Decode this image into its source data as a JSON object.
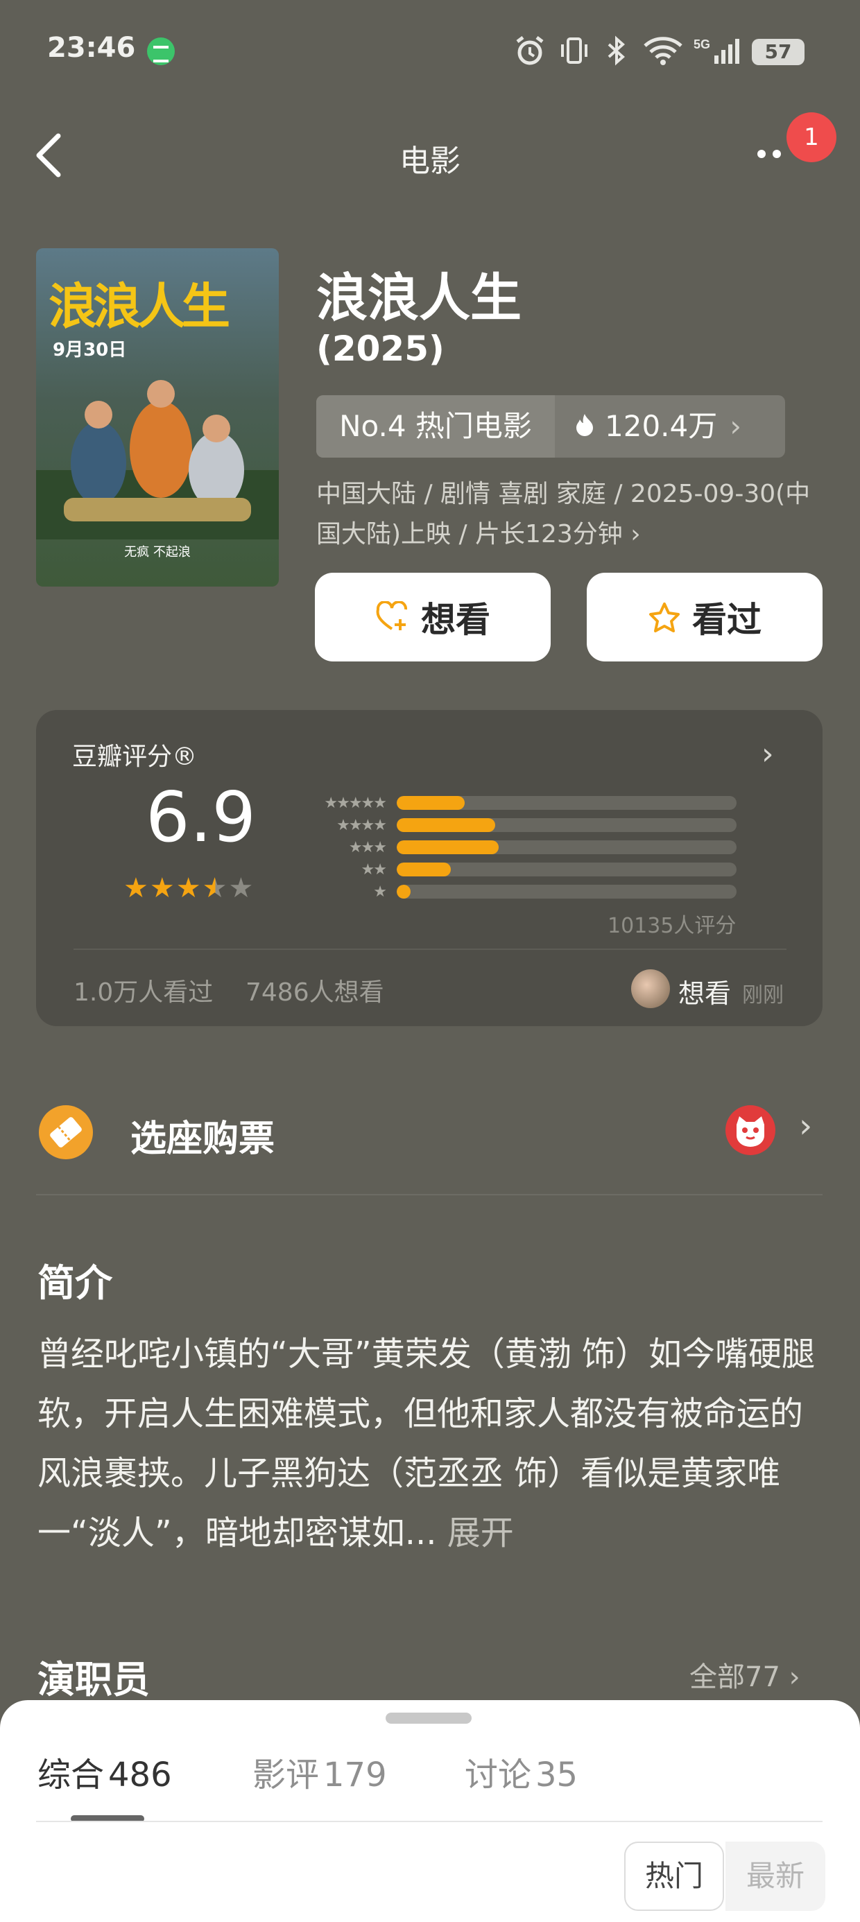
{
  "status_bar": {
    "time": "23:46",
    "battery": "57",
    "icons": [
      "message-app-icon",
      "alarm-icon",
      "vibrate-icon",
      "bluetooth-icon",
      "wifi-icon",
      "signal-5g-icon",
      "battery-icon"
    ]
  },
  "nav": {
    "title": "电影",
    "notification_count": "1"
  },
  "poster": {
    "title": "浪浪人生",
    "date": "9月30日",
    "tagline": "无疯 不起浪"
  },
  "movie": {
    "title": "浪浪人生",
    "year": "(2025)",
    "rank": "No.4 热门电影",
    "heat": "120.4万",
    "meta": "中国大陆 / 剧情 喜剧 家庭 / 2025-09-30(中国大陆)上映 / 片长123分钟 ›",
    "want_label": "想看",
    "seen_label": "看过"
  },
  "rating": {
    "label": "豆瓣评分®",
    "score": "6.9",
    "stars_value": 3.5,
    "distribution": [
      {
        "stars": "★★★★★",
        "fraction": 0.2
      },
      {
        "stars": "★★★★",
        "fraction": 0.29
      },
      {
        "stars": "★★★",
        "fraction": 0.3
      },
      {
        "stars": "★★",
        "fraction": 0.16
      },
      {
        "stars": "★",
        "fraction": 0.04
      }
    ],
    "count": "10135人评分",
    "seen_count": "1.0万人看过",
    "wish_count": "7486人想看",
    "friend_action": "想看",
    "friend_time": "刚刚"
  },
  "ticket": {
    "label": "选座购票"
  },
  "synopsis": {
    "heading": "简介",
    "text": "曾经叱咤小镇的“大哥”黄荣发（黄渤 饰）如今嘴硬腿软，开启人生困难模式，但他和家人都没有被命运的风浪裹挟。儿子黑狗达（范丞丞 饰）看似是黄家唯一“淡人”，暗地却密谋如...",
    "expand": " 展开"
  },
  "cast": {
    "heading": "演职员",
    "all": "全部77 ›"
  },
  "tabs": [
    {
      "label": "综合",
      "count": "486"
    },
    {
      "label": "影评",
      "count": "179"
    },
    {
      "label": "讨论",
      "count": "35"
    }
  ],
  "sort": {
    "hot": "热门",
    "new": "最新"
  },
  "colors": {
    "background": "#605f57",
    "accent": "#f5a411",
    "badge": "#ef4c4c"
  }
}
